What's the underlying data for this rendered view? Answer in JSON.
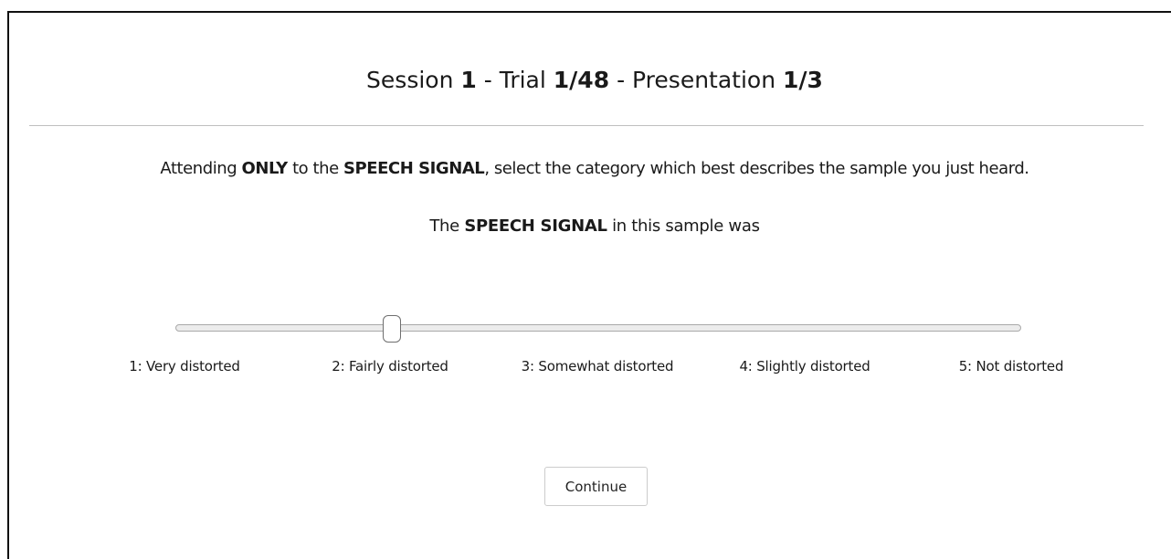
{
  "header": {
    "session_label": "Session",
    "session_value": "1",
    "sep1": "-",
    "trial_label": "Trial",
    "trial_value": "1/48",
    "sep2": "-",
    "presentation_label": "Presentation",
    "presentation_value": "1/3"
  },
  "instruction": {
    "part1": "Attending",
    "emph1": "ONLY",
    "part2": "to the",
    "emph2": "SPEECH SIGNAL",
    "part3": ", select the category which best describes the sample you just heard."
  },
  "prompt": {
    "part1": "The",
    "emph": "SPEECH SIGNAL",
    "part2": "in this sample was"
  },
  "slider": {
    "min": 1,
    "max": 5,
    "value": 2,
    "labels": [
      "1: Very distorted",
      "2: Fairly distorted",
      "3: Somewhat distorted",
      "4: Slightly distorted",
      "5: Not distorted"
    ]
  },
  "continue_button": {
    "label": "Continue"
  }
}
